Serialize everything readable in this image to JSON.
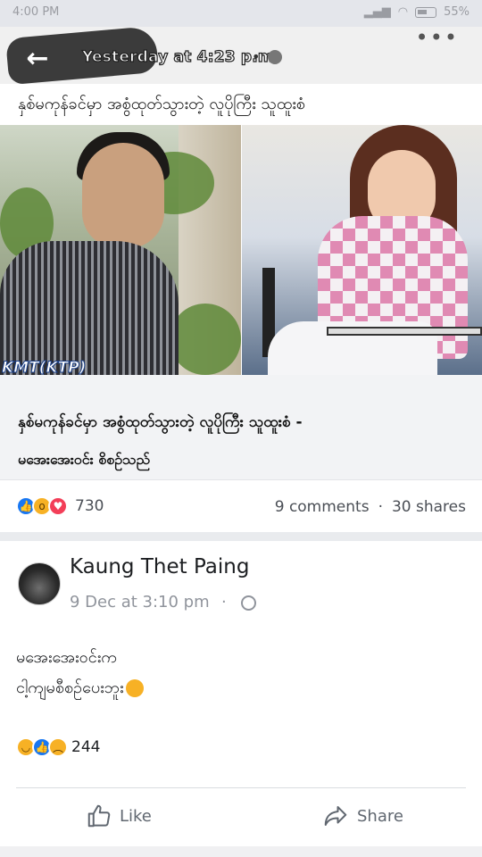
{
  "status_bar": {
    "time": "4:00 PM",
    "battery": "55%"
  },
  "header": {
    "timestamp": "Yesterday at 4:23 p.m.",
    "separator": "•",
    "more": "•••"
  },
  "post": {
    "caption": "နှစ်မကုန်ခင်မှာ အစွံထုတ်သွားတဲ့ လူပိုကြီး သူထူးစံ",
    "image_watermark": "KMT(KTP)",
    "link_title": "နှစ်မကုန်ခင်မှာ အစွံထုတ်သွားတဲ့ လူပိုကြီး သူထူးစံ  -",
    "link_subtitle": "မအေးအေးဝင်း စိစဉ်သည်"
  },
  "engagement": {
    "reaction_count": "730",
    "comments": "9 comments",
    "dot": "·",
    "shares": "30 shares"
  },
  "comment": {
    "author": "Kaung Thet Paing",
    "time": "9 Dec at 3:10 pm",
    "dot": "·",
    "line1": "မအေးအေးဝင်းက",
    "line2": "ငါ့ကျမစီစဉ်ပေးဘူး",
    "reaction_count": "244"
  },
  "actions": {
    "like": "Like",
    "share": "Share"
  },
  "icons": {
    "back": "back-arrow-icon",
    "globe": "globe-icon",
    "more": "more-icon",
    "like": "thumbs-up-icon",
    "share": "share-arrow-icon"
  }
}
